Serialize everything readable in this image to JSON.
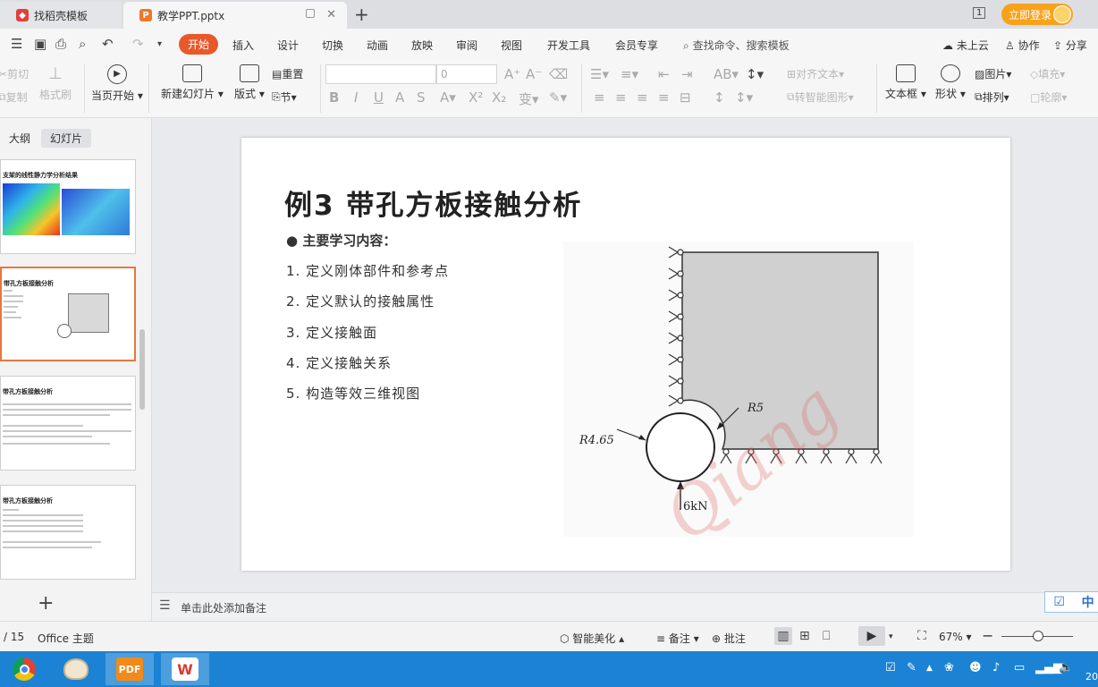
{
  "tabs": [
    {
      "label": "找稻壳模板"
    },
    {
      "label": "教学PPT.pptx"
    }
  ],
  "login": {
    "label": "立即登录"
  },
  "menu": {
    "items": [
      "开始",
      "插入",
      "设计",
      "切换",
      "动画",
      "放映",
      "审阅",
      "视图",
      "开发工具",
      "会员专享"
    ],
    "search_placeholder": "查找命令、搜索模板",
    "cloud": "未上云",
    "collab": "协作",
    "share": "分享"
  },
  "ribbon": {
    "cut": "剪切",
    "copy": "复制",
    "format_painter": "格式刷",
    "from_current": "当页开始",
    "new_slide": "新建幻灯片",
    "layout": "版式",
    "reset": "重置",
    "section": "节",
    "font_size": "0",
    "align_text": "对齐文本",
    "convert_smartart": "转智能图形",
    "textbox": "文本框",
    "shape": "形状",
    "picture": "图片",
    "fill": "填充",
    "arrange": "排列",
    "outline": "轮廓"
  },
  "panel": {
    "tab_outline": "大纲",
    "tab_slides": "幻灯片",
    "thumbs": [
      {
        "title": "支架的线性静力学分析结果"
      },
      {
        "title": "带孔方板接触分析"
      },
      {
        "title": "带孔方板接触分析"
      },
      {
        "title": "带孔方板接触分析"
      }
    ]
  },
  "slide": {
    "title": "例3 带孔方板接触分析",
    "subtitle": "主要学习内容：",
    "items": [
      "1. 定义刚体部件和参考点",
      "2. 定义默认的接触属性",
      "3. 定义接触面",
      "4. 定义接触关系",
      "5. 构造等效三维视图"
    ],
    "figure": {
      "label_r5": "R5",
      "label_r465": "R4.65",
      "label_load": "6kN"
    }
  },
  "notes": {
    "placeholder": "单击此处添加备注"
  },
  "ime": {
    "mode": "中"
  },
  "status": {
    "page": "/ 15",
    "theme": "Office 主题",
    "beautify": "智能美化",
    "notes": "备注",
    "comments": "批注",
    "zoom": "67%"
  },
  "taskbar": {
    "pdf": "PDF",
    "wps": "W",
    "clock": "20"
  },
  "colors": {
    "accent": "#e8582a",
    "login": "#f7a21b",
    "taskbar": "#1c83d4",
    "selected_thumb": "#e7773f"
  }
}
